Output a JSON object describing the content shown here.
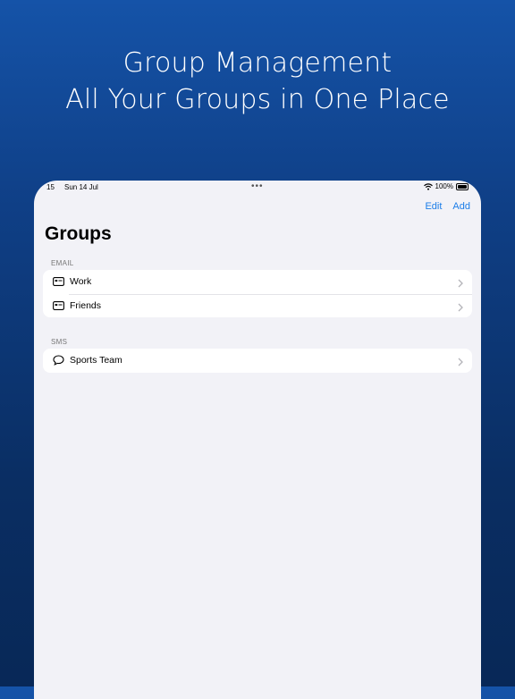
{
  "headline": {
    "line1": "Group Management",
    "line2": "All Your Groups in One Place"
  },
  "status_bar": {
    "time": "15",
    "date": "Sun 14 Jul",
    "battery": "100%"
  },
  "nav": {
    "edit_label": "Edit",
    "add_label": "Add",
    "title": "Groups"
  },
  "sections": [
    {
      "header": "EMAIL",
      "items": [
        {
          "label": "Work",
          "icon": "email-card-icon"
        },
        {
          "label": "Friends",
          "icon": "email-card-icon"
        }
      ]
    },
    {
      "header": "SMS",
      "items": [
        {
          "label": "Sports Team",
          "icon": "message-bubble-icon"
        }
      ]
    }
  ],
  "colors": {
    "accent": "#1a7ce8",
    "background_top": "#1553a8",
    "background_bottom": "#082857",
    "screen": "#f2f2f7"
  }
}
